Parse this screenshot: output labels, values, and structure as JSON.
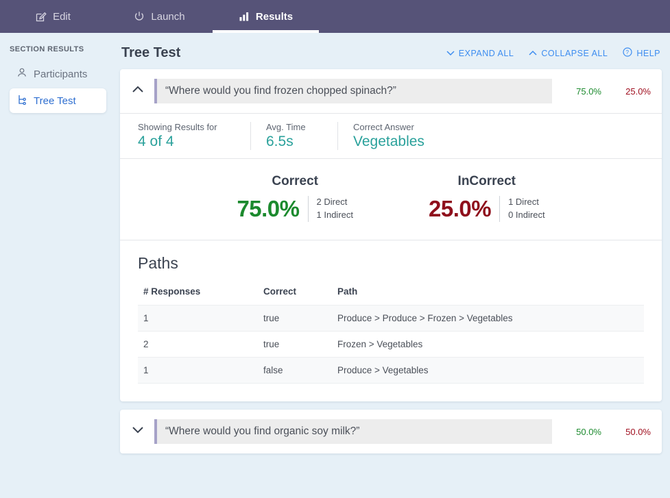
{
  "topnav": {
    "tabs": [
      {
        "label": "Edit",
        "icon": "edit-square-icon",
        "active": false
      },
      {
        "label": "Launch",
        "icon": "power-icon",
        "active": false
      },
      {
        "label": "Results",
        "icon": "bar-chart-icon",
        "active": true
      }
    ]
  },
  "sidebar": {
    "title": "SECTION RESULTS",
    "items": [
      {
        "label": "Participants",
        "icon": "user-icon",
        "active": false
      },
      {
        "label": "Tree Test",
        "icon": "tree-hierarchy-icon",
        "active": true
      }
    ]
  },
  "header": {
    "title": "Tree Test",
    "actions": [
      {
        "label": "EXPAND ALL",
        "icon": "chevron-down-icon"
      },
      {
        "label": "COLLAPSE ALL",
        "icon": "chevron-up-icon"
      },
      {
        "label": "HELP",
        "icon": "question-circle-icon"
      }
    ]
  },
  "question1": {
    "text": "“Where would you find frozen chopped spinach?”",
    "correct_pct": "75.0%",
    "incorrect_pct": "25.0%",
    "chevron": "chevron-up-icon",
    "stats": [
      {
        "label": "Showing Results for",
        "value": "4 of 4"
      },
      {
        "label": "Avg. Time",
        "value": "6.5s"
      },
      {
        "label": "Correct Answer",
        "value": "Vegetables"
      }
    ],
    "scores": {
      "correct": {
        "title": "Correct",
        "value": "75.0%",
        "direct": "2 Direct",
        "indirect": "1 Indirect"
      },
      "incorrect": {
        "title": "InCorrect",
        "value": "25.0%",
        "direct": "1 Direct",
        "indirect": "0 Indirect"
      }
    },
    "paths": {
      "title": "Paths",
      "columns": [
        "# Responses",
        "Correct",
        "Path"
      ],
      "rows": [
        {
          "responses": "1",
          "correct": "true",
          "path": "Produce > Produce > Frozen > Vegetables"
        },
        {
          "responses": "2",
          "correct": "true",
          "path": "Frozen > Vegetables"
        },
        {
          "responses": "1",
          "correct": "false",
          "path": "Produce > Vegetables"
        }
      ]
    }
  },
  "question2": {
    "text": "“Where would you find organic soy milk?”",
    "correct_pct": "50.0%",
    "incorrect_pct": "50.0%",
    "chevron": "chevron-down-icon"
  },
  "colors": {
    "navbar": "#565378",
    "page_bg": "#e6f0f7",
    "accent_link": "#3c8cf0",
    "teal": "#2aa19b",
    "green": "#1c8a2e",
    "red": "#8f0f1c",
    "band_accent": "#a6a2c8"
  }
}
